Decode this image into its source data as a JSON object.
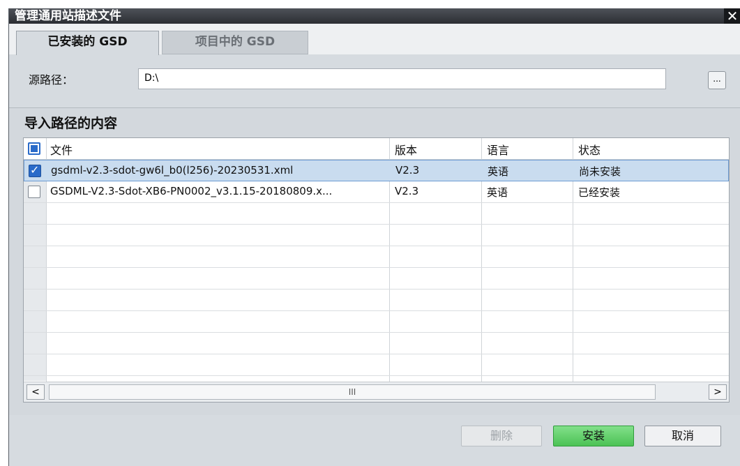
{
  "dialog": {
    "title": "管理通用站描述文件",
    "close_symbol": "✕"
  },
  "tabs": [
    {
      "label": "已安装的 GSD",
      "active": true
    },
    {
      "label": "项目中的 GSD",
      "active": false
    }
  ],
  "source": {
    "label": "源路径：",
    "value": "D:\\",
    "browse_label": "..."
  },
  "section": {
    "title": "导入路径的内容"
  },
  "table": {
    "columns": [
      "文件",
      "版本",
      "语言",
      "状态"
    ],
    "rows": [
      {
        "checked": true,
        "file": "gsdml-v2.3-sdot-gw6l_b0(l256)-20230531.xml",
        "version": "V2.3",
        "language": "英语",
        "status": "尚未安装"
      },
      {
        "checked": false,
        "file": "GSDML-V2.3-Sdot-XB6-PN0002_v3.1.15-20180809.x...",
        "version": "V2.3",
        "language": "英语",
        "status": "已经安装"
      }
    ]
  },
  "scrollbar": {
    "left_symbol": "<",
    "right_symbol": ">",
    "thumb_grip": "III"
  },
  "buttons": {
    "delete": "删除",
    "install": "安装",
    "cancel": "取消"
  },
  "colors": {
    "accent": "#2a6bc9",
    "install_green": "#4cc255",
    "selected_row": "#c9dcef"
  }
}
